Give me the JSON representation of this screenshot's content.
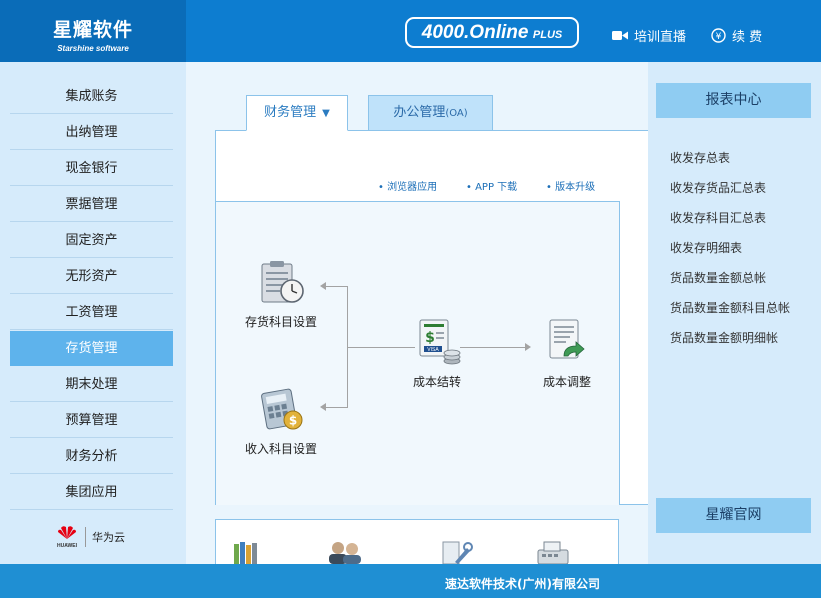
{
  "header": {
    "logo_title": "星耀软件",
    "logo_subtitle": "Starshine software",
    "version_main": "4000.Online",
    "version_plus": "PLUS",
    "live_label": "培训直播",
    "renew_label": "续 费"
  },
  "sidebar": {
    "items": [
      {
        "label": "集成账务"
      },
      {
        "label": "出纳管理"
      },
      {
        "label": "现金银行"
      },
      {
        "label": "票据管理"
      },
      {
        "label": "固定资产"
      },
      {
        "label": "无形资产"
      },
      {
        "label": "工资管理"
      },
      {
        "label": "存货管理",
        "active": true
      },
      {
        "label": "期末处理"
      },
      {
        "label": "预算管理"
      },
      {
        "label": "财务分析"
      },
      {
        "label": "集团应用"
      }
    ],
    "partner_wordmark": "HUAWEI",
    "partner_label": "华为云"
  },
  "tabs": {
    "finance": "财务管理",
    "office": "办公管理",
    "office_suffix": "(OA)"
  },
  "sublinks": {
    "browser": "浏览器应用",
    "app": "APP 下载",
    "upgrade": "版本升级"
  },
  "flow": {
    "inventory_subject": "存货科目设置",
    "income_subject": "收入科目设置",
    "cost_carryover": "成本结转",
    "cost_adjust": "成本调整"
  },
  "bottom_icons": [
    "books-icon",
    "users-icon",
    "tools-icon",
    "cash-register-icon"
  ],
  "right_panel": {
    "title": "报表中心",
    "reports": [
      "收发存总表",
      "收发存货品汇总表",
      "收发存科目汇总表",
      "收发存明细表",
      "货品数量金额总帐",
      "货品数量金额科目总帐",
      "货品数量金额明细帐"
    ],
    "official_site": "星耀官网"
  },
  "footer": {
    "company": "速达软件技术(广州)有限公司"
  },
  "colors": {
    "header_bg": "#0d7dd0",
    "sidebar_bg": "#d6ebfb",
    "active_item": "#5eb3ec",
    "panel_head": "#8fccf2",
    "footer_bg": "#1f8fd3"
  }
}
